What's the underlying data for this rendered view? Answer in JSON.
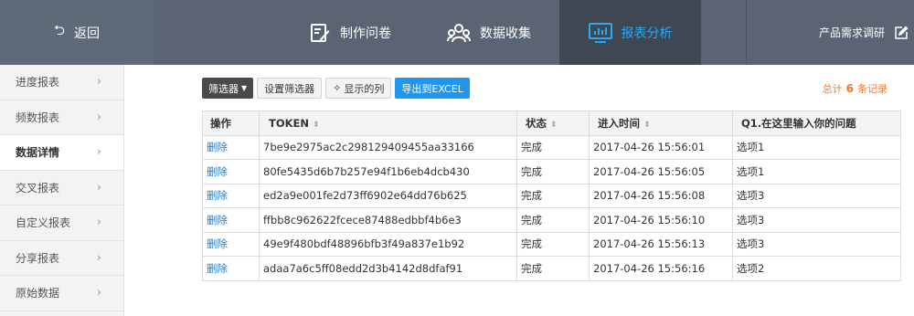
{
  "nav": {
    "back_label": "返回",
    "tabs": [
      {
        "label": "制作问卷",
        "icon": "edit-form-icon"
      },
      {
        "label": "数据收集",
        "icon": "users-icon"
      },
      {
        "label": "报表分析",
        "icon": "bar-chart-icon",
        "active": true
      }
    ],
    "project_title": "产品需求调研",
    "active_color": "#29a8f4"
  },
  "sidebar": {
    "items": [
      {
        "label": "进度报表"
      },
      {
        "label": "频数报表"
      },
      {
        "label": "数据详情",
        "active": true
      },
      {
        "label": "交叉报表"
      },
      {
        "label": "自定义报表"
      },
      {
        "label": "分享报表"
      },
      {
        "label": "原始数据"
      }
    ]
  },
  "toolbar": {
    "filter_label": "筛选器",
    "set_filter_label": "设置筛选器",
    "columns_label": "显示的列",
    "export_label": "导出到EXCEL"
  },
  "summary": {
    "prefix": "总计",
    "count": "6",
    "suffix": "条记录"
  },
  "table": {
    "headers": [
      "操作",
      "TOKEN",
      "状态",
      "进入时间",
      "Q1.在这里输入你的问题"
    ],
    "rows": [
      {
        "action": "删除",
        "token": "7be9e2975ac2c298129409455aa33166",
        "status": "完成",
        "time": "2017-04-26 15:56:01",
        "answer": "选项1"
      },
      {
        "action": "删除",
        "token": "80fe5435d6b7b257e94f1b6eb4dcb430",
        "status": "完成",
        "time": "2017-04-26 15:56:05",
        "answer": "选项1"
      },
      {
        "action": "删除",
        "token": "ed2a9e001fe2d73ff6902e64dd76b625",
        "status": "完成",
        "time": "2017-04-26 15:56:08",
        "answer": "选项3"
      },
      {
        "action": "删除",
        "token": "ffbb8c962622fcece87488edbbf4b6e3",
        "status": "完成",
        "time": "2017-04-26 15:56:10",
        "answer": "选项3"
      },
      {
        "action": "删除",
        "token": "49e9f480bdf48896bfb3f49a837e1b92",
        "status": "完成",
        "time": "2017-04-26 15:56:13",
        "answer": "选项3"
      },
      {
        "action": "删除",
        "token": "adaa7a6c5ff08edd2d3b4142d8dfaf91",
        "status": "完成",
        "time": "2017-04-26 15:56:16",
        "answer": "选项2"
      }
    ]
  }
}
